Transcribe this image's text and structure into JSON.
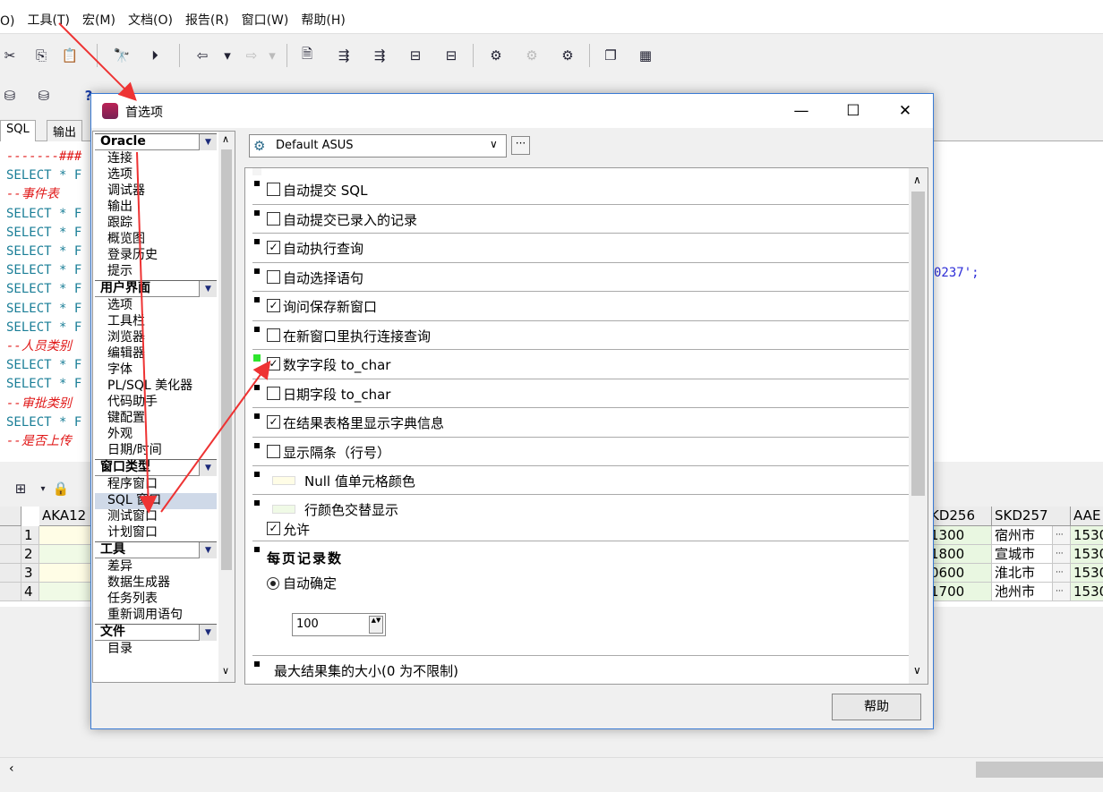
{
  "menu": [
    "O)",
    "工具(T)",
    "宏(M)",
    "文档(O)",
    "报告(R)",
    "窗口(W)",
    "帮助(H)"
  ],
  "sql_tabs": [
    "SQL",
    "输出"
  ],
  "editor": {
    "lines": [
      {
        "t": "-------###",
        "c": "cm"
      },
      {
        "t": "SELECT * F",
        "c": "kw"
      },
      {
        "t": "--事件表",
        "c": "cm"
      },
      {
        "t": "SELECT * F",
        "c": "kw"
      },
      {
        "t": "SELECT * F",
        "c": "kw"
      },
      {
        "t": "SELECT * F",
        "c": "kw"
      },
      {
        "t": "SELECT * F",
        "c": "kw"
      },
      {
        "t": "SELECT * F",
        "c": "kw"
      },
      {
        "t": "SELECT * F",
        "c": "kw"
      },
      {
        "t": "SELECT * F",
        "c": "kw"
      },
      {
        "t": "--人员类别",
        "c": "cm"
      },
      {
        "t": "SELECT * F",
        "c": "kw"
      },
      {
        "t": "SELECT * F",
        "c": "kw"
      },
      {
        "t": "--审批类别",
        "c": "cm"
      },
      {
        "t": "SELECT * F",
        "c": "kw"
      },
      {
        "t": "--是否上传",
        "c": "cm"
      }
    ],
    "right_fragment": "0237';"
  },
  "grid": {
    "headers_left": [
      "AKA12"
    ],
    "headers_right": [
      "KD256",
      "SKD257",
      "AAE"
    ],
    "rows": [
      {
        "n": "1",
        "a": "1300",
        "b": "宿州市",
        "c": "1530"
      },
      {
        "n": "2",
        "a": "1800",
        "b": "宣城市",
        "c": "1530"
      },
      {
        "n": "3",
        "a": "0600",
        "b": "淮北市",
        "c": "1530"
      },
      {
        "n": "4",
        "a": "1700",
        "b": "池州市",
        "c": "1530"
      }
    ],
    "ellipsis": "···"
  },
  "dialog": {
    "title": "首选项",
    "combo_value": "Default ASUS",
    "dots_label": "···",
    "help_label": "帮助",
    "tree": [
      {
        "type": "header",
        "label": "Oracle"
      },
      {
        "type": "item",
        "label": "连接"
      },
      {
        "type": "item",
        "label": "选项"
      },
      {
        "type": "item",
        "label": "调试器"
      },
      {
        "type": "item",
        "label": "输出"
      },
      {
        "type": "item",
        "label": "跟踪"
      },
      {
        "type": "item",
        "label": "概览图"
      },
      {
        "type": "item",
        "label": "登录历史"
      },
      {
        "type": "item",
        "label": "提示"
      },
      {
        "type": "header",
        "label": "用户界面"
      },
      {
        "type": "item",
        "label": "选项"
      },
      {
        "type": "item",
        "label": "工具栏"
      },
      {
        "type": "item",
        "label": "浏览器"
      },
      {
        "type": "item",
        "label": "编辑器"
      },
      {
        "type": "item",
        "label": "字体"
      },
      {
        "type": "item",
        "label": "PL/SQL 美化器"
      },
      {
        "type": "item",
        "label": "代码助手"
      },
      {
        "type": "item",
        "label": "键配置"
      },
      {
        "type": "item",
        "label": "外观"
      },
      {
        "type": "item",
        "label": "日期/时间"
      },
      {
        "type": "header",
        "label": "窗口类型"
      },
      {
        "type": "item",
        "label": "程序窗口"
      },
      {
        "type": "item",
        "label": "SQL 窗口",
        "selected": true
      },
      {
        "type": "item",
        "label": "测试窗口"
      },
      {
        "type": "item",
        "label": "计划窗口"
      },
      {
        "type": "header",
        "label": "工具"
      },
      {
        "type": "item",
        "label": "差异"
      },
      {
        "type": "item",
        "label": "数据生成器"
      },
      {
        "type": "item",
        "label": "任务列表"
      },
      {
        "type": "item",
        "label": "重新调用语句"
      },
      {
        "type": "header",
        "label": "文件"
      },
      {
        "type": "item",
        "label": "目录"
      }
    ],
    "options": [
      {
        "label": "自动提交 SQL",
        "checked": false
      },
      {
        "label": "自动提交已录入的记录",
        "checked": false
      },
      {
        "label": "自动执行查询",
        "checked": true
      },
      {
        "label": "自动选择语句",
        "checked": false
      },
      {
        "label": "询问保存新窗口",
        "checked": true
      },
      {
        "label": "在新窗口里执行连接查询",
        "checked": false
      },
      {
        "label": "数字字段 to_char",
        "checked": true,
        "highlight": true
      },
      {
        "label": "日期字段 to_char",
        "checked": false
      },
      {
        "label": "在结果表格里显示字典信息",
        "checked": true
      },
      {
        "label": "显示隔条（行号）",
        "checked": false
      }
    ],
    "null_color_label": "Null 值单元格颜色",
    "alt_color_label": "行颜色交替显示",
    "allow_label": "允许",
    "page_records_title": "每页记录数",
    "auto_determine_label": "自动确定",
    "page_records_value": "100",
    "max_result_label": "最大结果集的大小(0 为不限制)"
  }
}
